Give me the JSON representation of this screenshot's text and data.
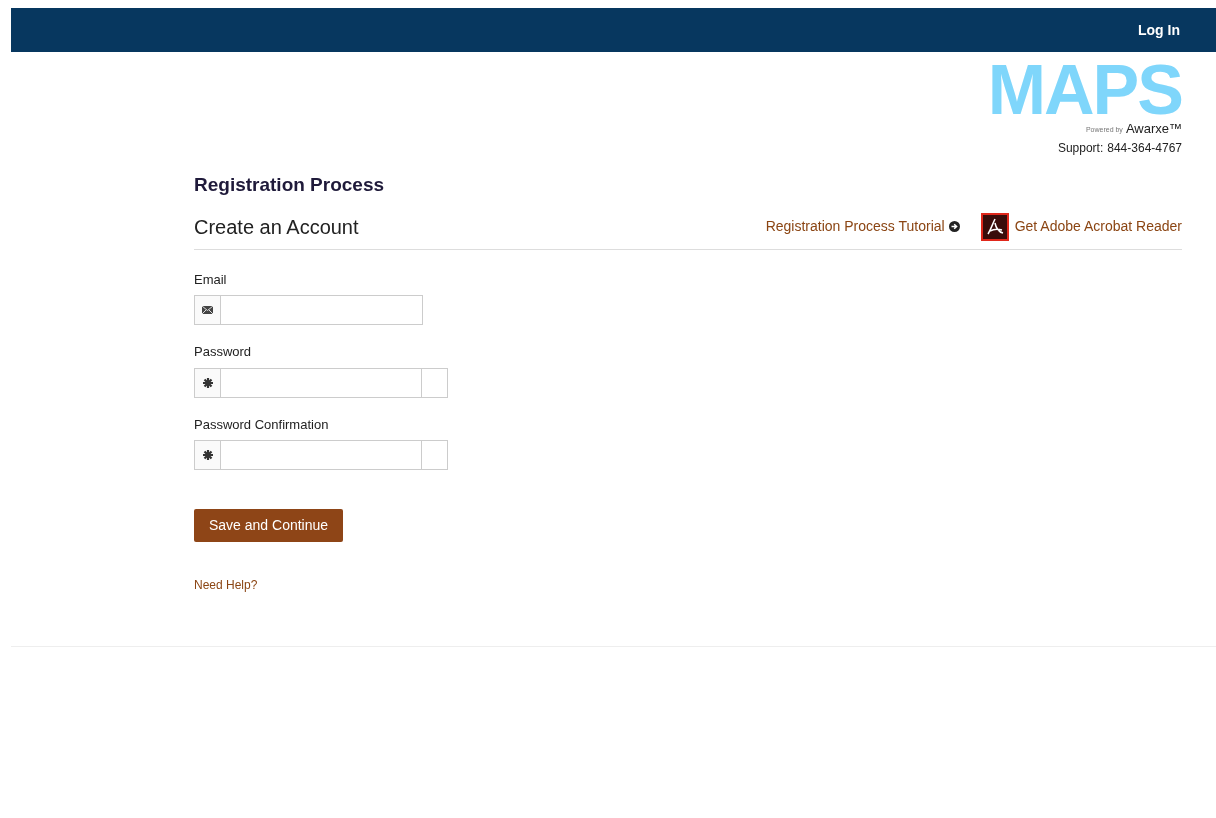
{
  "top_bar": {
    "login_link": "Log In"
  },
  "logo": {
    "title": "MAPS",
    "powered_by": "Powered by",
    "brand": "Awarxe™",
    "support_label": "Support:",
    "support_phone": "844-364-4767"
  },
  "page_title": "Registration Process",
  "section": {
    "title": "Create an Account",
    "tutorial_link": "Registration Process Tutorial",
    "acrobat_link": "Get Adobe Acrobat Reader"
  },
  "fields": [
    {
      "kind": "email",
      "label": "Email"
    },
    {
      "kind": "password",
      "label": "Password"
    },
    {
      "kind": "password",
      "label": "Password Confirmation"
    }
  ],
  "submit_button": "Save and Continue",
  "help_link": "Need Help?"
}
